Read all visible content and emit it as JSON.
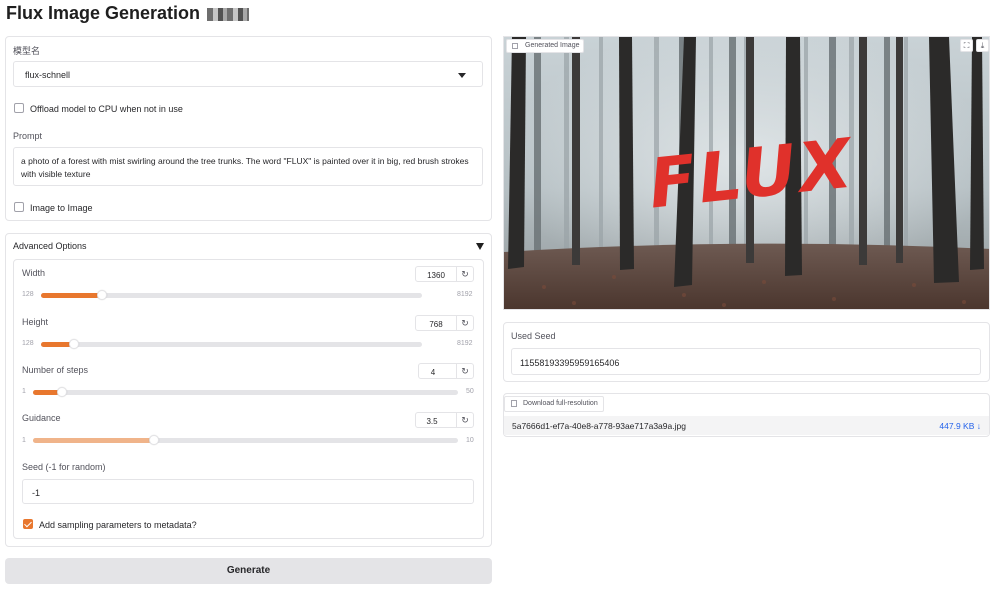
{
  "app": {
    "title": "Flux Image Generation"
  },
  "model": {
    "label": "模型名",
    "value": "flux-schnell"
  },
  "offload": {
    "label": "Offload model to CPU when not in use",
    "checked": false
  },
  "prompt": {
    "label": "Prompt",
    "value": "a photo of a forest with mist swirling around the tree trunks. The word \"FLUX\" is painted over it in big, red brush strokes with visible texture"
  },
  "img2img": {
    "label": "Image to Image",
    "checked": false
  },
  "advanced": {
    "title": "Advanced Options",
    "width": {
      "label": "Width",
      "value": "1360",
      "min": "128",
      "max": "8192",
      "fraction": 0.153
    },
    "height": {
      "label": "Height",
      "value": "768",
      "min": "128",
      "max": "8192",
      "fraction": 0.079
    },
    "steps": {
      "label": "Number of steps",
      "value": "4",
      "min": "1",
      "max": "50",
      "fraction": 0.061
    },
    "guidance": {
      "label": "Guidance",
      "value": "3.5",
      "min": "1",
      "max": "10",
      "fraction": 0.278
    },
    "seed": {
      "label": "Seed (-1 for random)",
      "value": "-1"
    },
    "metadata": {
      "label": "Add sampling parameters to metadata?",
      "checked": true
    }
  },
  "generate_label": "Generate",
  "output": {
    "image_label": "Generated Image",
    "image_word": "FLUX",
    "used_seed_label": "Used Seed",
    "used_seed_value": "11558193395959165406",
    "download_label": "Download full-resolution",
    "file_name": "5a7666d1-ef7a-40e8-a778-93ae717a3a9a.jpg",
    "file_size": "447.9 KB ↓"
  },
  "icons": {
    "reset": "reset-icon",
    "fullscreen": "fullscreen-icon",
    "download": "download-icon",
    "dropdown": "chevron-down-icon"
  },
  "colors": {
    "accent": "#e8772e",
    "accent_light": "#f0b48a",
    "link": "#2563eb",
    "flux_red": "#e0312b"
  }
}
